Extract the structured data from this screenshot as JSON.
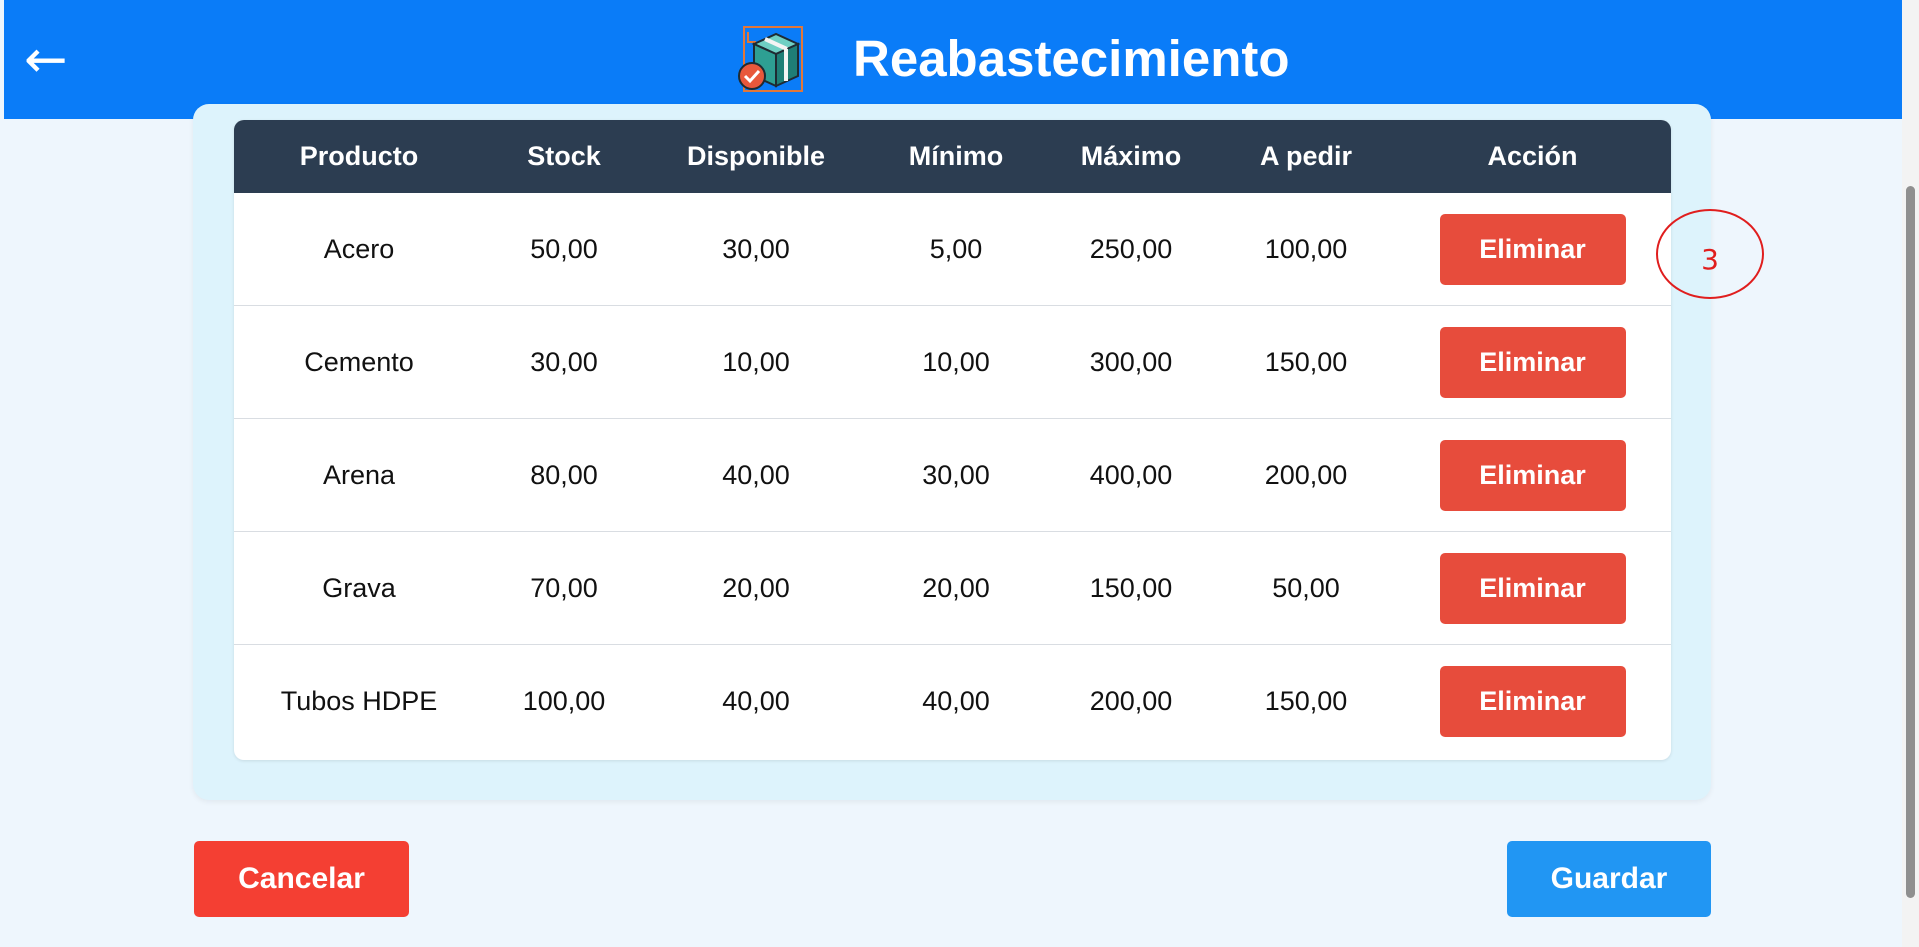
{
  "header": {
    "back_icon": "←",
    "title": "Reabastecimiento",
    "logo_icon": "box-restock-icon"
  },
  "table": {
    "columns": [
      "Producto",
      "Stock",
      "Disponible",
      "Mínimo",
      "Máximo",
      "A pedir",
      "Acción"
    ],
    "rows": [
      {
        "product": "Acero",
        "stock": "50,00",
        "available": "30,00",
        "min": "5,00",
        "max": "250,00",
        "to_order": "100,00",
        "action": "Eliminar"
      },
      {
        "product": "Cemento",
        "stock": "30,00",
        "available": "10,00",
        "min": "10,00",
        "max": "300,00",
        "to_order": "150,00",
        "action": "Eliminar"
      },
      {
        "product": "Arena",
        "stock": "80,00",
        "available": "40,00",
        "min": "30,00",
        "max": "400,00",
        "to_order": "200,00",
        "action": "Eliminar"
      },
      {
        "product": "Grava",
        "stock": "70,00",
        "available": "20,00",
        "min": "20,00",
        "max": "150,00",
        "to_order": "50,00",
        "action": "Eliminar"
      },
      {
        "product": "Tubos HDPE",
        "stock": "100,00",
        "available": "40,00",
        "min": "40,00",
        "max": "200,00",
        "to_order": "150,00",
        "action": "Eliminar"
      }
    ]
  },
  "annotation": {
    "text": "3"
  },
  "footer": {
    "cancel_label": "Cancelar",
    "save_label": "Guardar"
  },
  "colors": {
    "header": "#0a7cf8",
    "table_header": "#2c3d51",
    "delete": "#e74c3c",
    "cancel": "#f43f33",
    "save": "#2196f3",
    "annotation": "#e01e1e"
  }
}
